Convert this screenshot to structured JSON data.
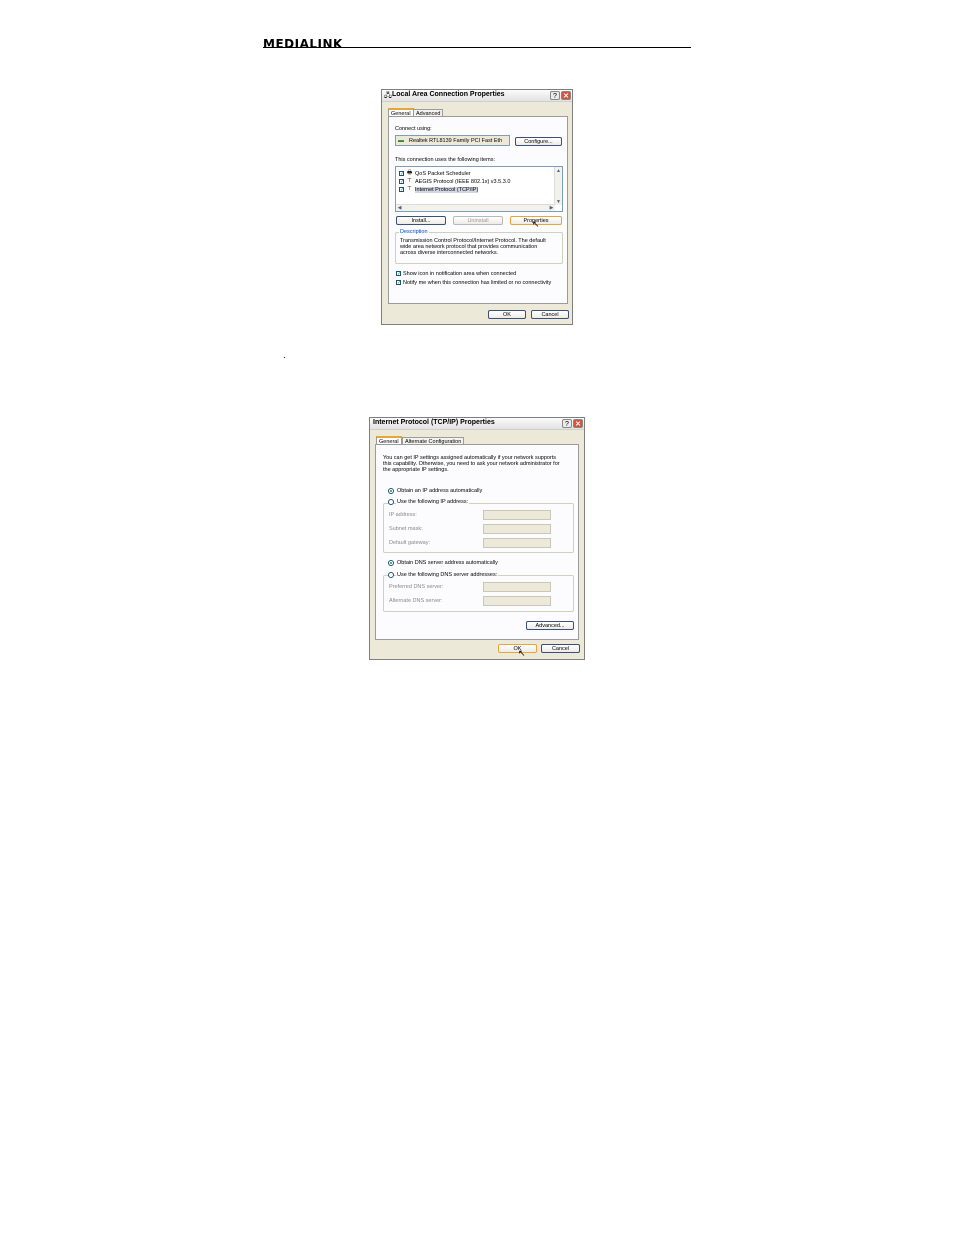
{
  "header": {
    "logo_text": "MEDIALINK"
  },
  "stray_text": ".",
  "lan_dialog": {
    "title": "Local Area Connection Properties",
    "help_button": "?",
    "close_button": "✕",
    "tabs": [
      "General",
      "Advanced"
    ],
    "connect_using_label": "Connect using:",
    "adapter_name": "Realtek RTL8139 Family PCI Fast Eth",
    "configure_button": "Configure...",
    "items_label": "This connection uses the following items:",
    "items": [
      {
        "label": "QoS Packet Scheduler",
        "checked": true
      },
      {
        "label": "AEGIS Protocol (IEEE 802.1x) v3.5.3.0",
        "checked": true
      },
      {
        "label": "Internet Protocol (TCP/IP)",
        "checked": true,
        "selected": true
      }
    ],
    "install_button": "Install...",
    "uninstall_button": "Uninstall",
    "properties_button": "Properties",
    "description_legend": "Description",
    "description_text_1": "Transmission Control Protocol/Internet Protocol. The default",
    "description_text_2": "wide area network protocol that provides communication",
    "description_text_3": "across diverse interconnected networks.",
    "show_icon_label": "Show icon in notification area when connected",
    "notify_label": "Notify me when this connection has limited or no connectivity",
    "ok_button": "OK",
    "cancel_button": "Cancel"
  },
  "tcpip_dialog": {
    "title": "Internet Protocol (TCP/IP) Properties",
    "help_button": "?",
    "close_button": "✕",
    "tabs": [
      "General",
      "Alternate Configuration"
    ],
    "intro_1": "You can get IP settings assigned automatically if your network supports",
    "intro_2": "this capability. Otherwise, you need to ask your network administrator for",
    "intro_3": "the appropriate IP settings.",
    "obtain_ip_label": "Obtain an IP address automatically",
    "use_ip_label": "Use the following IP address:",
    "ip_address_label": "IP address:",
    "subnet_mask_label": "Subnet mask:",
    "default_gateway_label": "Default gateway:",
    "obtain_dns_label": "Obtain DNS server address automatically",
    "use_dns_label": "Use the following DNS server addresses:",
    "preferred_dns_label": "Preferred DNS server:",
    "alternate_dns_label": "Alternate DNS server:",
    "advanced_button": "Advanced...",
    "ok_button": "OK",
    "cancel_button": "Cancel"
  }
}
